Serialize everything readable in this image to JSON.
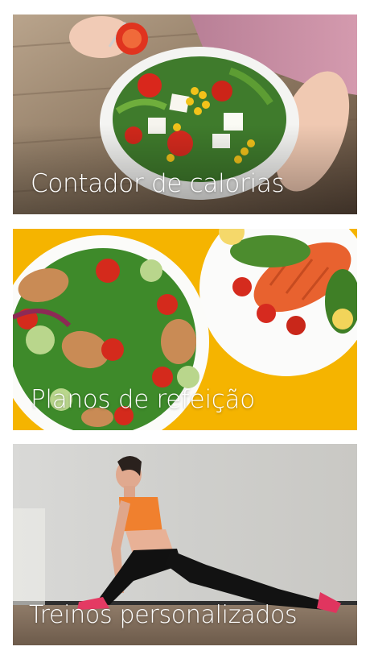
{
  "cards": [
    {
      "label": "Contador de calorias",
      "image": "salad-bowl-photo"
    },
    {
      "label": "Planos de refeição",
      "image": "meal-plates-photo"
    },
    {
      "label": "Treinos personalizados",
      "image": "stretching-woman-photo"
    }
  ],
  "colors": {
    "plans_background": "#F5B400",
    "label_text": "#FFFFFF"
  }
}
